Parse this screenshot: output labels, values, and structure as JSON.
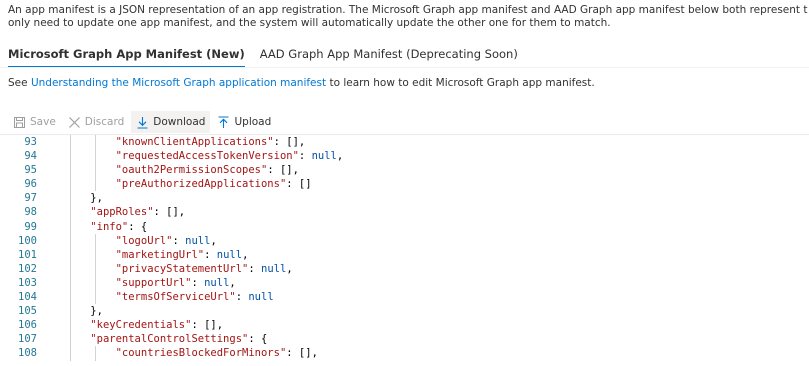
{
  "description": {
    "line1": "An app manifest is a JSON representation of an app registration. The Microsoft Graph app manifest and AAD Graph app manifest below both represent the settings of this app registration.",
    "line2": "only need to update one app manifest, and the system will automatically update the other one for them to match."
  },
  "tabs": [
    {
      "label": "Microsoft Graph App Manifest (New)",
      "active": true
    },
    {
      "label": "AAD Graph App Manifest (Deprecating Soon)",
      "active": false
    }
  ],
  "see_line": {
    "prefix": "See ",
    "link": "Understanding the Microsoft Graph application manifest",
    "suffix": " to learn how to edit Microsoft Graph app manifest."
  },
  "toolbar": {
    "save_label": "Save",
    "discard_label": "Discard",
    "download_label": "Download",
    "upload_label": "Upload"
  },
  "editor": {
    "lines": [
      {
        "n": "93",
        "indent": 2,
        "tokens": [
          [
            "k",
            "\"knownClientApplications\""
          ],
          [
            "p",
            ": [],"
          ]
        ]
      },
      {
        "n": "94",
        "indent": 2,
        "tokens": [
          [
            "k",
            "\"requestedAccessTokenVersion\""
          ],
          [
            "p",
            ": "
          ],
          [
            "kw",
            "null"
          ],
          [
            "p",
            ","
          ]
        ]
      },
      {
        "n": "95",
        "indent": 2,
        "tokens": [
          [
            "k",
            "\"oauth2PermissionScopes\""
          ],
          [
            "p",
            ": [],"
          ]
        ]
      },
      {
        "n": "96",
        "indent": 2,
        "tokens": [
          [
            "k",
            "\"preAuthorizedApplications\""
          ],
          [
            "p",
            ": []"
          ]
        ]
      },
      {
        "n": "97",
        "indent": 1,
        "tokens": [
          [
            "p",
            "},"
          ]
        ]
      },
      {
        "n": "98",
        "indent": 1,
        "tokens": [
          [
            "k",
            "\"appRoles\""
          ],
          [
            "p",
            ": [],"
          ]
        ]
      },
      {
        "n": "99",
        "indent": 1,
        "tokens": [
          [
            "k",
            "\"info\""
          ],
          [
            "p",
            ": {"
          ]
        ]
      },
      {
        "n": "100",
        "indent": 2,
        "tokens": [
          [
            "k",
            "\"logoUrl\""
          ],
          [
            "p",
            ": "
          ],
          [
            "kw",
            "null"
          ],
          [
            "p",
            ","
          ]
        ]
      },
      {
        "n": "101",
        "indent": 2,
        "tokens": [
          [
            "k",
            "\"marketingUrl\""
          ],
          [
            "p",
            ": "
          ],
          [
            "kw",
            "null"
          ],
          [
            "p",
            ","
          ]
        ]
      },
      {
        "n": "102",
        "indent": 2,
        "tokens": [
          [
            "k",
            "\"privacyStatementUrl\""
          ],
          [
            "p",
            ": "
          ],
          [
            "kw",
            "null"
          ],
          [
            "p",
            ","
          ]
        ]
      },
      {
        "n": "103",
        "indent": 2,
        "tokens": [
          [
            "k",
            "\"supportUrl\""
          ],
          [
            "p",
            ": "
          ],
          [
            "kw",
            "null"
          ],
          [
            "p",
            ","
          ]
        ]
      },
      {
        "n": "104",
        "indent": 2,
        "tokens": [
          [
            "k",
            "\"termsOfServiceUrl\""
          ],
          [
            "p",
            ": "
          ],
          [
            "kw",
            "null"
          ]
        ]
      },
      {
        "n": "105",
        "indent": 1,
        "tokens": [
          [
            "p",
            "},"
          ]
        ]
      },
      {
        "n": "106",
        "indent": 1,
        "tokens": [
          [
            "k",
            "\"keyCredentials\""
          ],
          [
            "p",
            ": [],"
          ]
        ]
      },
      {
        "n": "107",
        "indent": 1,
        "tokens": [
          [
            "k",
            "\"parentalControlSettings\""
          ],
          [
            "p",
            ": {"
          ]
        ]
      },
      {
        "n": "108",
        "indent": 2,
        "tokens": [
          [
            "k",
            "\"countriesBlockedForMinors\""
          ],
          [
            "p",
            ": [],"
          ]
        ]
      }
    ]
  }
}
